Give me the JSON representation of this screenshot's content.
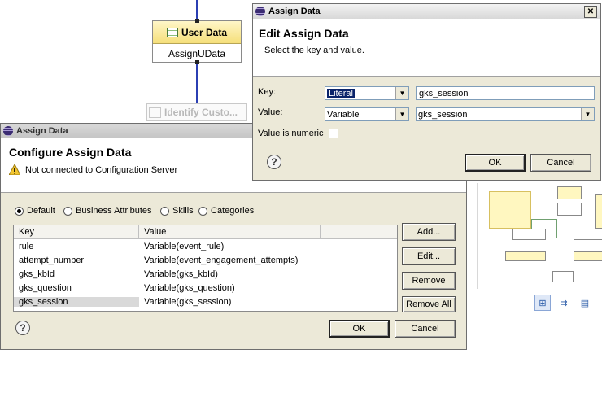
{
  "canvas": {
    "node1_title": "User Data",
    "node1_name": "AssignUData",
    "node2_title": "Identify Custo..."
  },
  "edit_dialog": {
    "title": "Assign Data",
    "header": "Edit Assign Data",
    "subtitle": "Select the key and value.",
    "key_label": "Key:",
    "key_type": "Literal",
    "key_value": "gks_session",
    "value_label": "Value:",
    "value_type": "Variable",
    "value_value": "gks_session",
    "numeric_label": "Value is numeric",
    "ok": "OK",
    "cancel": "Cancel",
    "close_glyph": "✕"
  },
  "config_dialog": {
    "title": "Assign Data",
    "header": "Configure Assign Data",
    "warning": "Not connected to Configuration Server",
    "radios": [
      "Default",
      "Business Attributes",
      "Skills",
      "Categories"
    ],
    "columns": [
      "Key",
      "Value"
    ],
    "rows": [
      {
        "key": "rule",
        "value": "Variable(event_rule)"
      },
      {
        "key": "attempt_number",
        "value": "Variable(event_engagement_attempts)"
      },
      {
        "key": "gks_kbId",
        "value": "Variable(gks_kbId)"
      },
      {
        "key": "gks_question",
        "value": "Variable(gks_question)"
      },
      {
        "key": "gks_session",
        "value": "Variable(gks_session)"
      }
    ],
    "add": "Add...",
    "edit": "Edit...",
    "remove": "Remove",
    "remove_all": "Remove All",
    "ok": "OK",
    "cancel": "Cancel"
  },
  "help_glyph": "?",
  "colors": {
    "dialog_bg": "#ece9d8",
    "selection": "#0a246a",
    "flow_line": "#2b3fb3"
  }
}
